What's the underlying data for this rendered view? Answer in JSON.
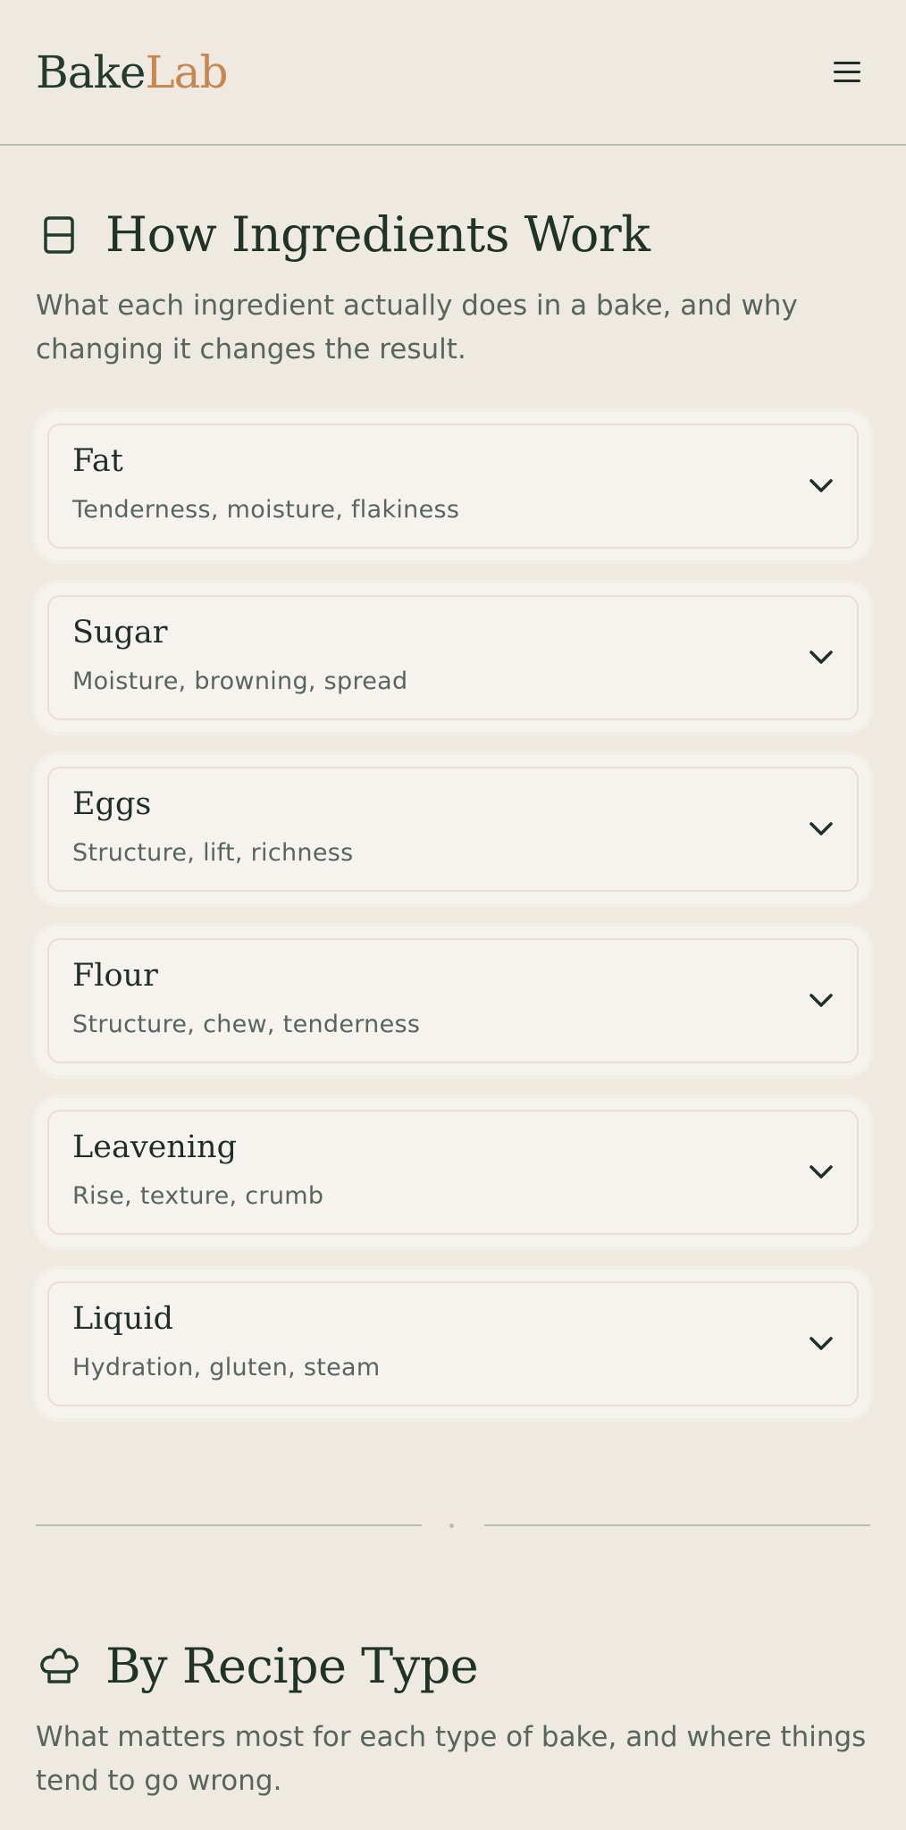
{
  "header": {
    "logo_primary": "Bake",
    "logo_accent": "Lab"
  },
  "colors": {
    "background": "#efeae1",
    "brand_green": "#223b2d",
    "brand_accent": "#c7874f",
    "card_bg": "#f6f3ee",
    "card_border": "#ecdcd2",
    "muted_text": "#58655d"
  },
  "ingredients_section": {
    "icon": "jar-icon",
    "title": "How Ingredients Work",
    "description": "What each ingredient actually does in a bake, and why changing it changes the result.",
    "items": [
      {
        "name": "Fat",
        "subtitle": "Tenderness, moisture, flakiness"
      },
      {
        "name": "Sugar",
        "subtitle": "Moisture, browning, spread"
      },
      {
        "name": "Eggs",
        "subtitle": "Structure, lift, richness"
      },
      {
        "name": "Flour",
        "subtitle": "Structure, chew, tenderness"
      },
      {
        "name": "Leavening",
        "subtitle": "Rise, texture, crumb"
      },
      {
        "name": "Liquid",
        "subtitle": "Hydration, gluten, steam"
      }
    ]
  },
  "recipe_section": {
    "icon": "chef-hat-icon",
    "title": "By Recipe Type",
    "description": "What matters most for each type of bake, and where things tend to go wrong."
  }
}
